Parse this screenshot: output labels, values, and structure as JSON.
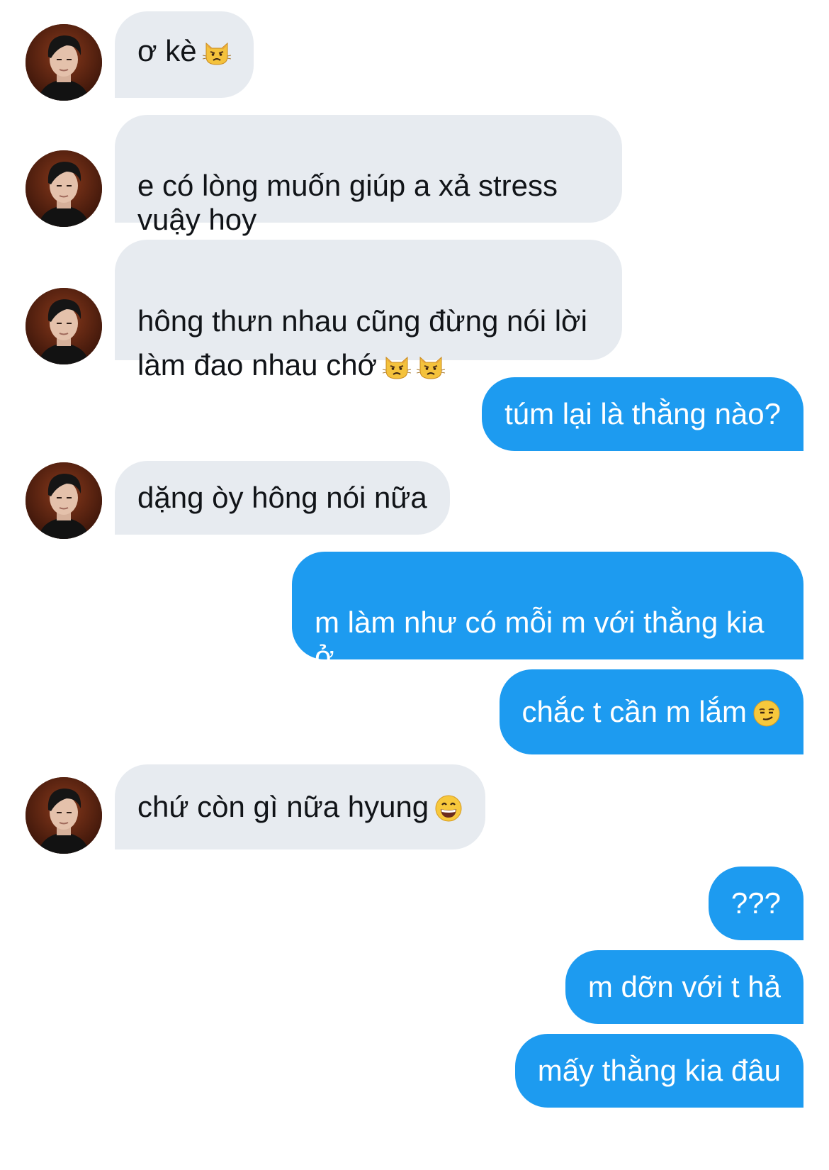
{
  "conversation": {
    "messages": [
      {
        "sender": "them",
        "text": "ơ kè",
        "emoji": [
          "pouting-cat"
        ]
      },
      {
        "sender": "them",
        "text": "e có lòng muốn giúp a xả stress\nvuậy hoy"
      },
      {
        "sender": "them",
        "text": "hông thưn nhau cũng đừng nói lời\nlàm đao nhau chớ",
        "emoji": [
          "pouting-cat",
          "pouting-cat"
        ]
      },
      {
        "sender": "me",
        "text": "túm lại là thằng nào?"
      },
      {
        "sender": "them",
        "text": "dặng òy hông nói nữa"
      },
      {
        "sender": "me",
        "text": "m làm như có mỗi m với thằng kia ở\nktx v á"
      },
      {
        "sender": "me",
        "text": "chắc t cần m lắm",
        "emoji": [
          "smirking-face"
        ]
      },
      {
        "sender": "them",
        "text": "chứ còn gì nữa hyung",
        "emoji": [
          "grinning-face"
        ]
      },
      {
        "sender": "me",
        "text": "???"
      },
      {
        "sender": "me",
        "text": "m dỡn với t hả"
      },
      {
        "sender": "me",
        "text": "mấy thằng kia đâu"
      }
    ]
  },
  "colors": {
    "incoming_bubble": "#e7ebf0",
    "outgoing_bubble": "#1d9bf0",
    "incoming_text": "#111418",
    "outgoing_text": "#ffffff"
  }
}
